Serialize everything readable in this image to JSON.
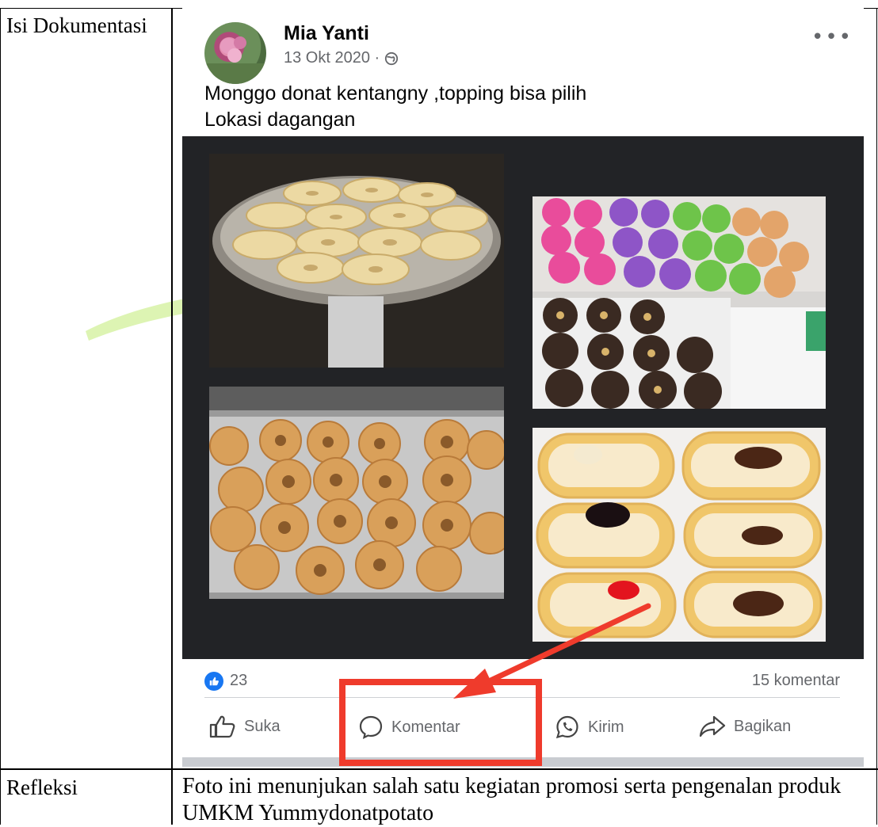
{
  "table": {
    "row1_label": "Isi Dokumentasi",
    "row2_label": "Refleksi",
    "reflection": "Foto ini menunjukan salah satu kegiatan promosi serta pengenalan produk UMKM Yummydonatpotato"
  },
  "post": {
    "author": "Mia Yanti",
    "date": "13 Okt 2020 ·",
    "caption_line1": "Monggo donat kentangny ,topping bisa pilih",
    "caption_line2": "Lokasi dagangan",
    "like_count": "23",
    "comment_count": "15 komentar",
    "actions": {
      "like": "Suka",
      "comment": "Komentar",
      "send": "Kirim",
      "share": "Bagikan"
    }
  },
  "colors": {
    "highlight": "#ef3b2c",
    "facebook_blue": "#1877f2"
  },
  "icons": [
    "globe-icon",
    "more-icon",
    "like-badge-icon",
    "thumbs-up-icon",
    "comment-icon",
    "whatsapp-icon",
    "share-icon",
    "arrow-icon"
  ]
}
